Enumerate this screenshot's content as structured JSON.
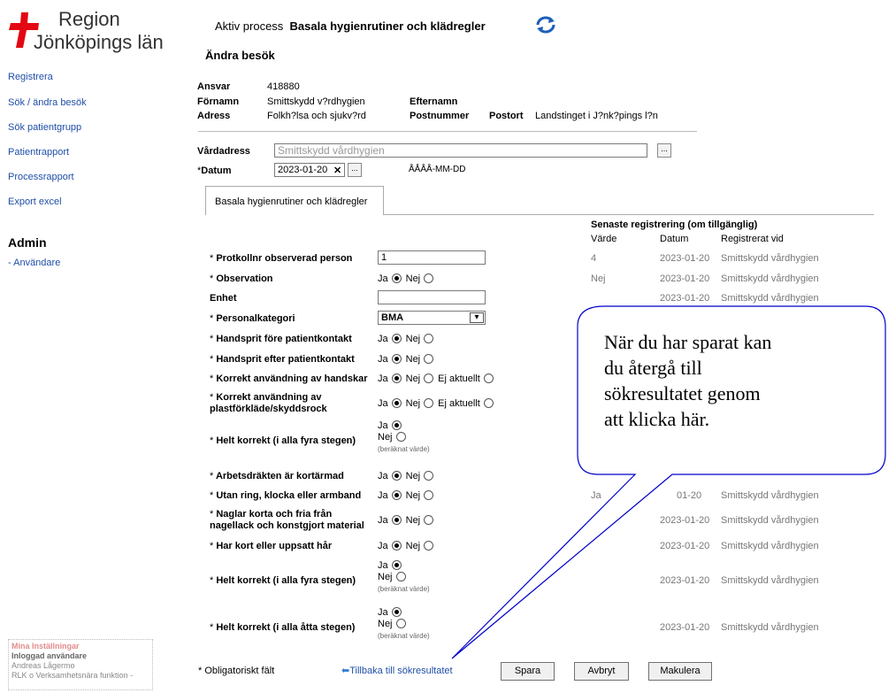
{
  "logo": {
    "line1": "Region",
    "line2": "Jönköpings län",
    "brand_red": "#e30613"
  },
  "nav": [
    {
      "label": "Registrera"
    },
    {
      "label": "Sök / ändra besök"
    },
    {
      "label": "Sök patientgrupp"
    },
    {
      "label": "Patientrapport"
    },
    {
      "label": "Processrapport"
    },
    {
      "label": "Export excel"
    }
  ],
  "admin": {
    "heading": "Admin",
    "link": "- Användare"
  },
  "settings": {
    "title": "Mina Inställningar",
    "logged_in_label": "Inloggad användare",
    "user": "Andreas Lågermo",
    "unit": "RLK o Verksamhetsnära funktion -"
  },
  "header": {
    "process_label": "Aktiv process",
    "process_name": "Basala hygienrutiner och klädregler",
    "refresh_icon": "refresh-icon",
    "page_title": "Ändra besök"
  },
  "info": {
    "ansvar_label": "Ansvar",
    "ansvar": "418880",
    "fornamn_label": "Förnamn",
    "fornamn": "Smittskydd v?rdhygien",
    "efternamn_label": "Efternamn",
    "efternamn": "",
    "adress_label": "Adress",
    "adress": "Folkh?lsa och sjukv?rd",
    "postnummer_label": "Postnummer",
    "postnummer": "",
    "postort_label": "Postort",
    "postort": "Landstinget i J?nk?pings l?n"
  },
  "form": {
    "vardadress_label": "Vårdadress",
    "vardadress_value": "Smittskydd vårdhygien",
    "datum_label": "Datum",
    "datum_value": "2023-01-20",
    "datum_format": "ÅÅÅÅ-MM-DD",
    "dots": "..."
  },
  "tab": {
    "label": "Basala hygienrutiner och klädregler"
  },
  "history": {
    "heading": "Senaste registrering (om tillgänglig)",
    "col_value": "Värde",
    "col_date": "Datum",
    "col_registered": "Registrerat vid"
  },
  "rows": {
    "protokoll": {
      "label": "Protkollnr observerad person",
      "value": "1",
      "h_value": "4",
      "h_date": "2023-01-20",
      "h_reg": "Smittskydd vårdhygien"
    },
    "observation": {
      "label": "Observation",
      "h_value": "Nej",
      "h_date": "2023-01-20",
      "h_reg": "Smittskydd vårdhygien"
    },
    "enhet": {
      "label": "Enhet",
      "value": "",
      "h_date": "2023-01-20",
      "h_reg": "Smittskydd vårdhygien"
    },
    "personal": {
      "label": "Personalkategori",
      "value": "BMA"
    },
    "handsprit_fore": {
      "label": "Handsprit före patientkontakt"
    },
    "handsprit_efter": {
      "label": "Handsprit efter patientkontakt"
    },
    "handskar": {
      "label": "Korrekt användning av handskar"
    },
    "plast1": {
      "label": "Korrekt användning av"
    },
    "plast2": {
      "label": "plastförkläde/skyddsrock"
    },
    "helt_fyra_1": {
      "label": "Helt korrekt (i alla fyra stegen)"
    },
    "arbetsdrakt": {
      "label": "Arbetsdräkten är kortärmad"
    },
    "ring": {
      "label": "Utan ring, klocka eller armband",
      "h_value": "Ja",
      "h_date": "01-20",
      "h_reg": "Smittskydd vårdhygien"
    },
    "naglar1": {
      "label": "Naglar korta och fria från",
      "h_date": "2023-01-20",
      "h_reg": "Smittskydd vårdhygien"
    },
    "naglar2": {
      "label": "nagellack och konstgjort material"
    },
    "har": {
      "label": "Har kort eller uppsatt hår",
      "h_date": "2023-01-20",
      "h_reg": "Smittskydd vårdhygien"
    },
    "helt_fyra_2": {
      "label": "Helt korrekt (i alla fyra stegen)",
      "h_date": "2023-01-20",
      "h_reg": "Smittskydd vårdhygien"
    },
    "helt_atta": {
      "label": "Helt korrekt (i alla åtta stegen)",
      "h_date": "2023-01-20",
      "h_reg": "Smittskydd vårdhygien"
    }
  },
  "opts": {
    "ja": "Ja",
    "nej": "Nej",
    "ej": "Ej aktuellt",
    "hint": "(beräknat värde)",
    "ast": "*"
  },
  "footer": {
    "mandatory": "Obligatoriskt fält",
    "back_link": "Tillbaka till sökresultatet",
    "save": "Spara",
    "cancel": "Avbryt",
    "void": "Makulera"
  },
  "callout": {
    "line1": "När du har sparat kan",
    "line2": "du återgå till",
    "line3": "sökresultatet genom",
    "line4": "att klicka här.",
    "stroke": "#0000cc"
  }
}
